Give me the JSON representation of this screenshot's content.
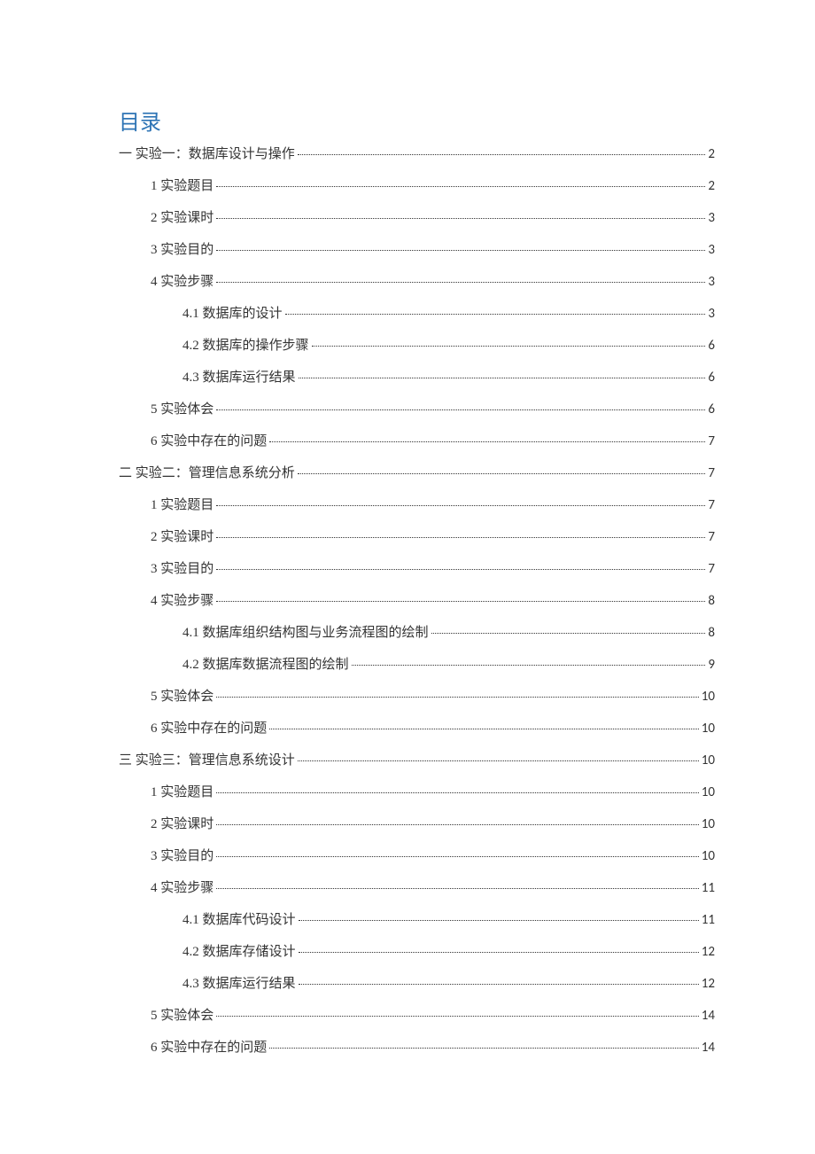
{
  "title": "目录",
  "entries": [
    {
      "level": 0,
      "label": "一  实验一：数据库设计与操作",
      "page": "2"
    },
    {
      "level": 1,
      "label": "1  实验题目",
      "page": "2"
    },
    {
      "level": 1,
      "label": "2  实验课时",
      "page": "3"
    },
    {
      "level": 1,
      "label": "3  实验目的",
      "page": "3"
    },
    {
      "level": 1,
      "label": "4  实验步骤",
      "page": "3"
    },
    {
      "level": 2,
      "label": "4.1  数据库的设计",
      "page": "3"
    },
    {
      "level": 2,
      "label": "4.2  数据库的操作步骤",
      "page": "6"
    },
    {
      "level": 2,
      "label": "4.3  数据库运行结果",
      "page": "6"
    },
    {
      "level": 1,
      "label": "5  实验体会",
      "page": "6"
    },
    {
      "level": 1,
      "label": "6  实验中存在的问题",
      "page": "7"
    },
    {
      "level": 0,
      "label": "二  实验二：管理信息系统分析",
      "page": "7"
    },
    {
      "level": 1,
      "label": "1  实验题目",
      "page": "7"
    },
    {
      "level": 1,
      "label": "2  实验课时",
      "page": "7"
    },
    {
      "level": 1,
      "label": "3  实验目的",
      "page": "7"
    },
    {
      "level": 1,
      "label": "4  实验步骤",
      "page": "8"
    },
    {
      "level": 2,
      "label": "4.1  数据库组织结构图与业务流程图的绘制",
      "page": "8"
    },
    {
      "level": 2,
      "label": "4.2  数据库数据流程图的绘制",
      "page": "9"
    },
    {
      "level": 1,
      "label": "5  实验体会",
      "page": "10"
    },
    {
      "level": 1,
      "label": "6  实验中存在的问题",
      "page": "10"
    },
    {
      "level": 0,
      "label": "三  实验三：管理信息系统设计",
      "page": "10"
    },
    {
      "level": 1,
      "label": "1  实验题目",
      "page": "10"
    },
    {
      "level": 1,
      "label": "2  实验课时",
      "page": "10"
    },
    {
      "level": 1,
      "label": "3  实验目的",
      "page": "10"
    },
    {
      "level": 1,
      "label": "4  实验步骤",
      "page": "11"
    },
    {
      "level": 2,
      "label": "4.1  数据库代码设计",
      "page": "11"
    },
    {
      "level": 2,
      "label": "4.2  数据库存储设计",
      "page": "12"
    },
    {
      "level": 2,
      "label": "4.3  数据库运行结果",
      "page": "12"
    },
    {
      "level": 1,
      "label": "5  实验体会",
      "page": "14"
    },
    {
      "level": 1,
      "label": "6  实验中存在的问题",
      "page": "14"
    }
  ]
}
